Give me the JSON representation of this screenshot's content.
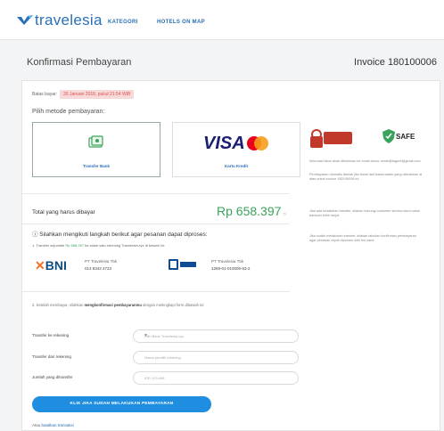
{
  "app": {
    "name": "travelesia"
  },
  "nav": {
    "items": [
      "KATEGORI",
      "HOTELS ON MAP"
    ]
  },
  "header": {
    "title": "Konfirmasi Pembayaran",
    "invoice": "Invoice 180100006"
  },
  "payment": {
    "deadline_label": "Batas bayar:",
    "deadline_value": "26 Januari 2018, pukul 21:54 WIB",
    "method_title": "Pilih metode pembayaran:",
    "methods": [
      {
        "label": "Transfer Bank",
        "icon": "bank-transfer-icon",
        "selected": true
      },
      {
        "label": "Kartu Kredit",
        "brand": "VISA",
        "icon": "mastercard-icon",
        "selected": false
      }
    ],
    "badges": [
      "SAFE"
    ],
    "note_1": "Informasi akun akan dikirimkan ke email kamu: email@tagunt@gmail.com",
    "note_2": "Pembayaran otomatis ditolak jika lewat dari batas waktu yang ditentukan di atas untuk invoice 180100006 ini.",
    "total_label": "Total yang harus dibayar",
    "total_value": "Rp 658.397",
    "total_suffix": "○",
    "side_note_total": "Jika ada kesalahan transfer, silakan hubungi customer service kami untuk bantuan lebih lanjut.",
    "side_note_bank": "Jika sudah melakukan transfer, silakan lakukan konfirmasi pembayaran agar pesanan cepat diproses oleh tim kami.",
    "instructions_title": "ⓘ Silahkan mengikuti langkah berikut agar pesanan dapat diproses:",
    "step1_prefix": "1. Transfer sejumlah",
    "step1_amount": "Rp 658.397",
    "step1_suffix": "ke salah satu rekening Travelesia.xyz di bawah ini:",
    "banks": [
      {
        "name": "BNI",
        "holder": "PT Travelesia Tbk",
        "account": "013 8342 4723"
      },
      {
        "name": "BRI",
        "holder": "PT Travelesia Tbk",
        "account": "1269-01-010006-53-2"
      }
    ],
    "step2_prefix": "2. Setelah membayar, silahkan",
    "step2_bold": "mengkonfirmasi pembayaranmu",
    "step2_suffix": "dengan melengkapi form dibawah ini:",
    "form": {
      "bank_to_label": "Transfer ke rekening",
      "bank_to_placeholder": "Pilih Bank Travelesia.xyz",
      "bank_from_label": "Transfer dari rekening",
      "bank_from_placeholder": "Nama pemilik rekening",
      "amount_label": "Jumlah yang ditransfer",
      "amount_placeholder": "IDR 123.456"
    },
    "confirm_button": "KLIK JIKA SUDAH MELAKUKAN PEMBAYARAN",
    "or_text": "Atau",
    "cancel_link": "batalkan transaksi"
  },
  "colors": {
    "brand": "#2a6fb8",
    "accent": "#1f8ee0",
    "success": "#3aa35a",
    "warning_bg": "#f8d9d9"
  }
}
